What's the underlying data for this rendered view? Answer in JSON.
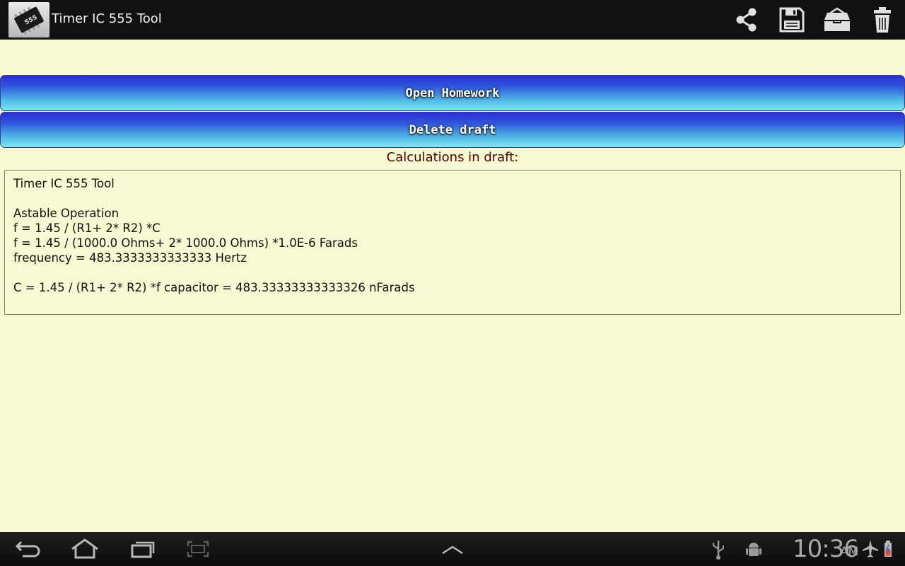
{
  "app": {
    "title": "Timer IC 555 Tool",
    "icon": "ic-chip-icon",
    "chip_label": "555"
  },
  "actions": {
    "share": "share-icon",
    "save": "save-icon",
    "open": "open-folder-icon",
    "delete": "trash-icon"
  },
  "buttons": {
    "open_homework": "Open Homework",
    "delete_draft": "Delete draft"
  },
  "draft": {
    "label": "Calculations in draft:",
    "lines": [
      "Timer IC 555 Tool",
      "",
      "Astable Operation",
      "f = 1.45 / (R1+ 2* R2) *C",
      "f = 1.45 / (1000.0 Ohms+ 2* 1000.0 Ohms) *1.0E-6 Farads",
      "frequency = 483.3333333333333 Hertz",
      "",
      "C = 1.45 / (R1+ 2* R2) *f capacitor = 483.33333333333326 nFarads"
    ]
  },
  "system_bar": {
    "time": "10:36",
    "ampm": "AM",
    "icons": [
      "back-icon",
      "home-icon",
      "recent-apps-icon",
      "screenshot-icon",
      "chevron-up-icon",
      "usb-icon",
      "android-debug-icon",
      "airplane-mode-icon",
      "battery-icon"
    ]
  },
  "colors": {
    "background": "#f8f8d2",
    "actionbar": "#111111",
    "button_top": "#2a2fd6",
    "button_bottom": "#7de7f2",
    "label_text": "#4a0000"
  }
}
